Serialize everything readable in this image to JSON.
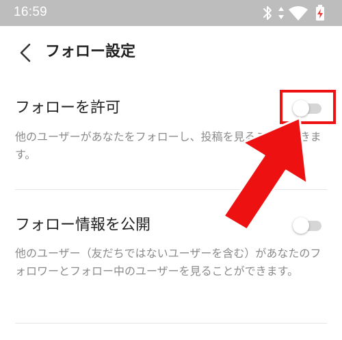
{
  "status_bar": {
    "time": "16:59",
    "icons": [
      "bluetooth-icon",
      "data-arrows-icon",
      "wifi-icon",
      "battery-charging-icon"
    ]
  },
  "header": {
    "back_icon": "chevron-left-icon",
    "title": "フォロー設定"
  },
  "settings": [
    {
      "title": "フォローを許可",
      "description": "他のユーザーがあなたをフォローし、投稿を見ることができます。",
      "toggle_on": false
    },
    {
      "title": "フォロー情報を公開",
      "description": "他のユーザー（友だちではないユーザーを含む）があなたのフォロワーとフォロー中のユーザーを見ることができます。",
      "toggle_on": false
    }
  ],
  "annotation": {
    "highlight_color": "#ee1111",
    "arrow_color": "#ee1111"
  },
  "colors": {
    "status_bar_bg": "#bdbdbd",
    "toggle_track_off": "#d6d6d6"
  }
}
